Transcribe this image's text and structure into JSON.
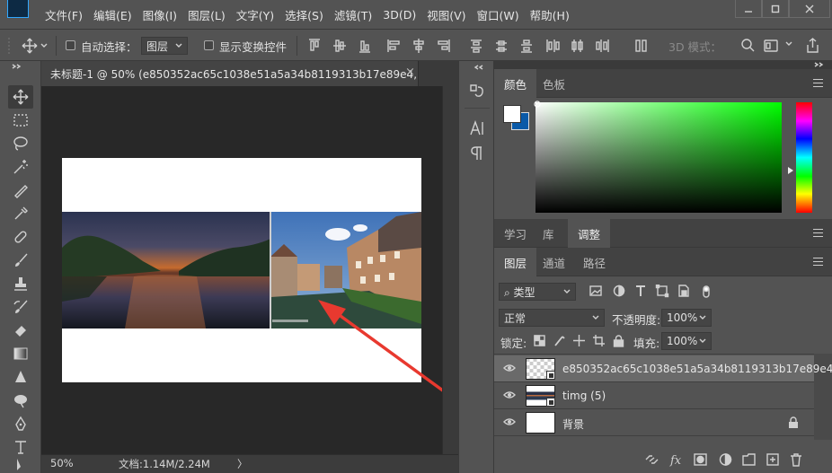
{
  "menubar": {
    "items": [
      "文件(F)",
      "编辑(E)",
      "图像(I)",
      "图层(L)",
      "文字(Y)",
      "选择(S)",
      "滤镜(T)",
      "3D(D)",
      "视图(V)",
      "窗口(W)",
      "帮助(H)"
    ]
  },
  "options": {
    "auto_select_label": "自动选择：",
    "auto_select_value": "图层",
    "show_transform_label": "显示变换控件",
    "mode_label": "3D 模式："
  },
  "document": {
    "tab_title": "未标题-1 @ 50% (e850352ac65c1038e51a5a34b8119313b17e89e4, ...",
    "close": "×",
    "zoom": "50%",
    "doc_info": "文档:1.14M/2.24M",
    "more": "〉"
  },
  "color_panel": {
    "tabs": [
      "颜色",
      "色板"
    ],
    "foreground": "#ffffff",
    "background": "#0a5aa8"
  },
  "learn_panel": {
    "tabs": [
      "学习",
      "库",
      "调整"
    ]
  },
  "layers_panel": {
    "tabs": [
      "图层",
      "通道",
      "路径"
    ],
    "filter_kind": "类型",
    "blend_mode": "正常",
    "opacity_label": "不透明度:",
    "opacity_value": "100%",
    "lock_label": "锁定:",
    "fill_label": "填充:",
    "fill_value": "100%",
    "layers": [
      {
        "name": "e850352ac65c1038e51a5a34b8119313b17e89e4",
        "selected": true
      },
      {
        "name": "timg (5)",
        "selected": false
      },
      {
        "name": "背景",
        "selected": false,
        "locked": true
      }
    ]
  },
  "colors": {
    "accent_arrow": "#e8392f",
    "panel_bg": "#535353"
  }
}
